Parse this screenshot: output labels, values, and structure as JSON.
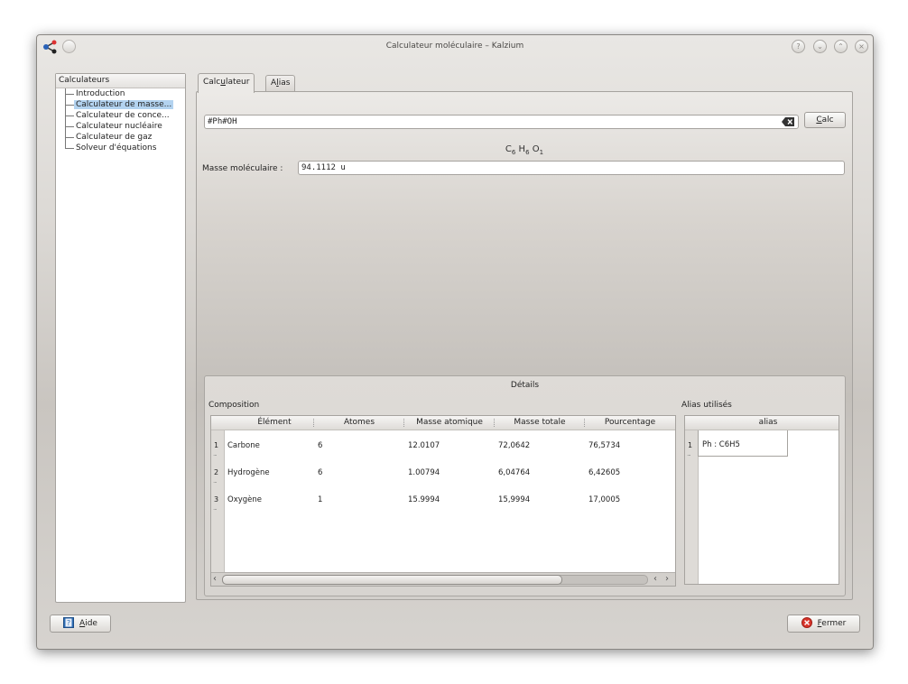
{
  "window": {
    "title": "Calculateur moléculaire – Kalzium",
    "title_buttons": [
      "?",
      "⌄",
      "⌃",
      "×"
    ]
  },
  "tree": {
    "header": "Calculateurs",
    "items": [
      {
        "label": "Introduction",
        "selected": false
      },
      {
        "label": "Calculateur de masse...",
        "selected": true
      },
      {
        "label": "Calculateur de conce...",
        "selected": false
      },
      {
        "label": "Calculateur nucléaire",
        "selected": false
      },
      {
        "label": "Calculateur de gaz",
        "selected": false
      },
      {
        "label": "Solveur d'équations",
        "selected": false
      }
    ]
  },
  "tabs": [
    {
      "label_pre": "Calc",
      "label_u": "u",
      "label_post": "lateur",
      "active": true
    },
    {
      "label_pre": "A",
      "label_u": "l",
      "label_post": "ias",
      "active": false
    }
  ],
  "calculator": {
    "formula_value": "#Ph#OH",
    "calc_pre": "",
    "calc_u": "C",
    "calc_post": "alc",
    "formula_display": [
      {
        "el": "C",
        "n": "6"
      },
      {
        "el": "H",
        "n": "6"
      },
      {
        "el": "O",
        "n": "1"
      }
    ],
    "mass_label": "Masse moléculaire :",
    "mass_value": "94.1112 u"
  },
  "details": {
    "title": "Détails",
    "composition_label": "Composition",
    "alias_label": "Alias utilisés",
    "columns": [
      "Élément",
      "Atomes",
      "Masse atomique",
      "Masse totale",
      "Pourcentage"
    ],
    "rows": [
      {
        "num": "1",
        "element": "Carbone",
        "atoms": "6",
        "atomic_mass": "12.0107",
        "total_mass": "72,0642",
        "percentage": "76,5734"
      },
      {
        "num": "2",
        "element": "Hydrogène",
        "atoms": "6",
        "atomic_mass": "1.00794",
        "total_mass": "6,04764",
        "percentage": "6,42605"
      },
      {
        "num": "3",
        "element": "Oxygène",
        "atoms": "1",
        "atomic_mass": "15.9994",
        "total_mass": "15,9994",
        "percentage": "17,0005"
      }
    ],
    "alias_column": "alias",
    "alias_rows": [
      {
        "num": "1",
        "value": "Ph : C6H5"
      }
    ]
  },
  "footer": {
    "help_u": "A",
    "help_post": "ide",
    "close_u": "F",
    "close_post": "ermer"
  },
  "colors": {
    "selection": "#b3d3f0",
    "close_icon": "#d9342b",
    "help_icon": "#2f6fb6"
  }
}
